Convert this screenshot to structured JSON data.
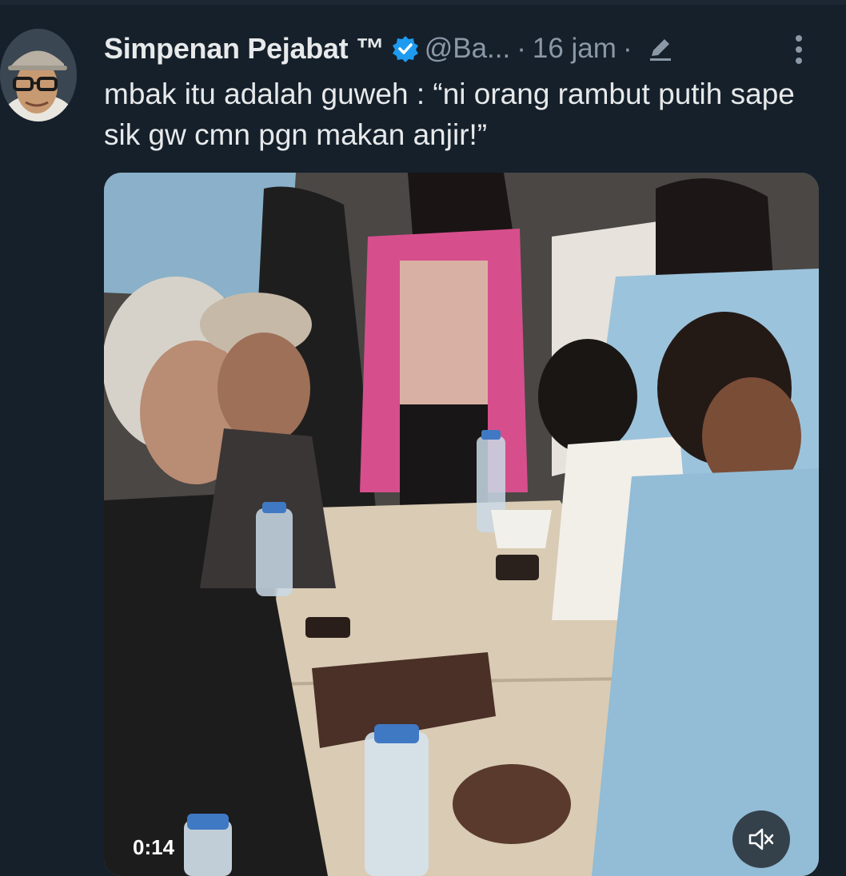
{
  "tweet": {
    "display_name": "Simpenan Pejabat ™",
    "handle": "@Ba...",
    "separator": "·",
    "timestamp": "16 jam",
    "text": "mbak itu adalah guweh : “ni orang rambut putih sape sik gw cmn pgn makan anjir!”",
    "verified": true
  },
  "media": {
    "type": "video",
    "playback_time": "0:14",
    "volume_icon": "speaker-muted-icon"
  },
  "icons": {
    "verified": "verified-badge-icon",
    "edit": "edit-pencil-icon",
    "more": "more-options-icon"
  },
  "colors": {
    "background": "#15202b",
    "text_primary": "#e7e9ea",
    "text_secondary": "#8b98a5",
    "verified": "#1d9bf0"
  }
}
